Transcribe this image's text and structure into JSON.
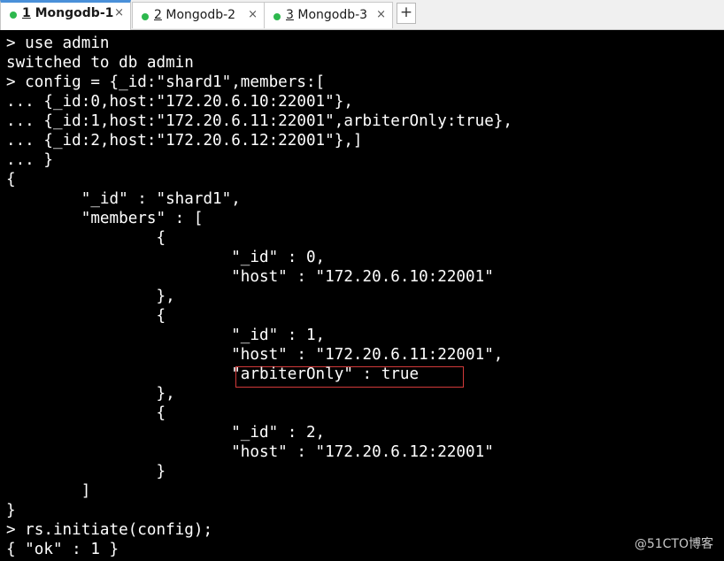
{
  "tabs": [
    {
      "number": "1",
      "title": " Mongodb-1",
      "close": "×",
      "active": true,
      "status_color": "#2db84d"
    },
    {
      "number": "2",
      "title": " Mongodb-2",
      "close": "×",
      "active": false,
      "status_color": "#2db84d"
    },
    {
      "number": "3",
      "title": " Mongodb-3",
      "close": "×",
      "active": false,
      "status_color": "#2db84d"
    }
  ],
  "add_tab_label": "+",
  "terminal": {
    "lines": [
      "> use admin",
      "switched to db admin",
      "> config = {_id:\"shard1\",members:[",
      "... {_id:0,host:\"172.20.6.10:22001\"},",
      "... {_id:1,host:\"172.20.6.11:22001\",arbiterOnly:true},",
      "... {_id:2,host:\"172.20.6.12:22001\"},]",
      "... }",
      "{",
      "        \"_id\" : \"shard1\",",
      "        \"members\" : [",
      "                {",
      "                        \"_id\" : 0,",
      "                        \"host\" : \"172.20.6.10:22001\"",
      "                },",
      "                {",
      "                        \"_id\" : 1,",
      "                        \"host\" : \"172.20.6.11:22001\",",
      "                        \"arbiterOnly\" : true",
      "                },",
      "                {",
      "                        \"_id\" : 2,",
      "                        \"host\" : \"172.20.6.12:22001\"",
      "                }",
      "        ]",
      "}",
      "> rs.initiate(config);",
      "{ \"ok\" : 1 }"
    ]
  },
  "watermark": "@51CTO博客",
  "colors": {
    "terminal_bg": "#000000",
    "terminal_fg": "#ffffff",
    "highlight_border": "#d23a3a",
    "active_tab_accent": "#4a90d9"
  }
}
